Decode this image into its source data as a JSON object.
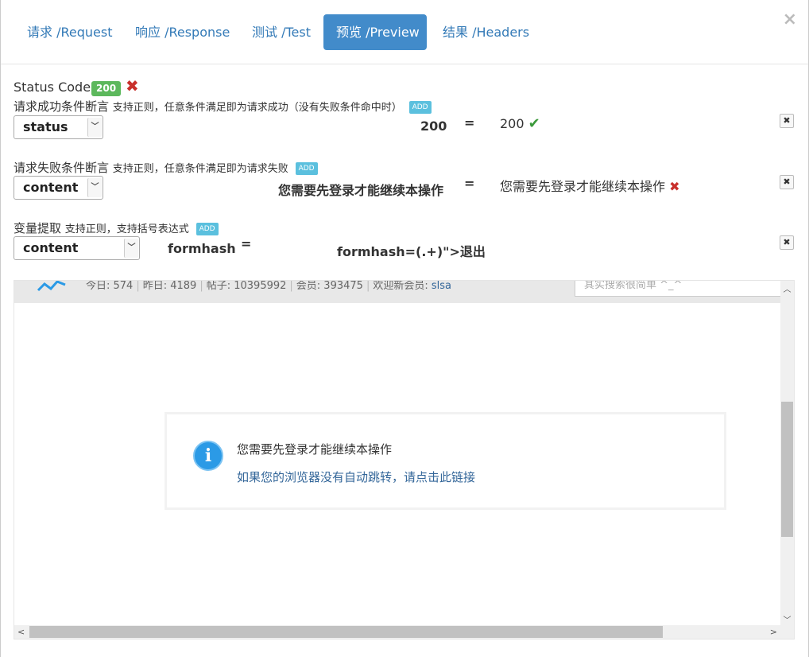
{
  "tabs": [
    {
      "label": "请求 /Request"
    },
    {
      "label": "响应 /Response"
    },
    {
      "label": "测试 /Test"
    },
    {
      "label": "预览 /Preview"
    },
    {
      "label": "结果 /Headers"
    }
  ],
  "close_glyph": "×",
  "status": {
    "label": "Status Code:",
    "code": "200",
    "fail_glyph": "✖"
  },
  "success_rule": {
    "title": "请求成功条件断言",
    "hint": "支持正则，任意条件满足即为请求成功（没有失败条件命中时）",
    "add": "ADD",
    "field": "status",
    "value": "200",
    "eq": "=",
    "result": "200",
    "result_glyph": "✔",
    "remove": "✖"
  },
  "fail_rule": {
    "title": "请求失败条件断言",
    "hint": "支持正则，任意条件满足即为请求失败",
    "add": "ADD",
    "field": "content",
    "value": "您需要先登录才能继续本操作",
    "eq": "=",
    "result": "您需要先登录才能继续本操作",
    "result_glyph": "✖",
    "remove": "✖"
  },
  "extract_rule": {
    "title": "变量提取",
    "hint": "支持正则，支持括号表达式",
    "add": "ADD",
    "field": "content",
    "name": "formhash",
    "eq": "=",
    "pattern": "formhash=(.+)\">退出",
    "remove": "✖"
  },
  "preview": {
    "stats": {
      "today": "今日: 574",
      "yesterday": "昨日: 4189",
      "posts": "帖子: 10395992",
      "members": "会员: 393475",
      "welcome": "欢迎新会员:",
      "new_user": "slsa"
    },
    "search_placeholder": "其实搜索很简单 ^_^",
    "message": "您需要先登录才能继续本操作",
    "link": "如果您的浏览器没有自动跳转，请点击此链接",
    "info_glyph": "i"
  },
  "colors": {
    "primary": "#428bca",
    "success": "#5cb85c",
    "danger": "#c9302c",
    "info": "#5bc0de",
    "link": "#336699"
  }
}
